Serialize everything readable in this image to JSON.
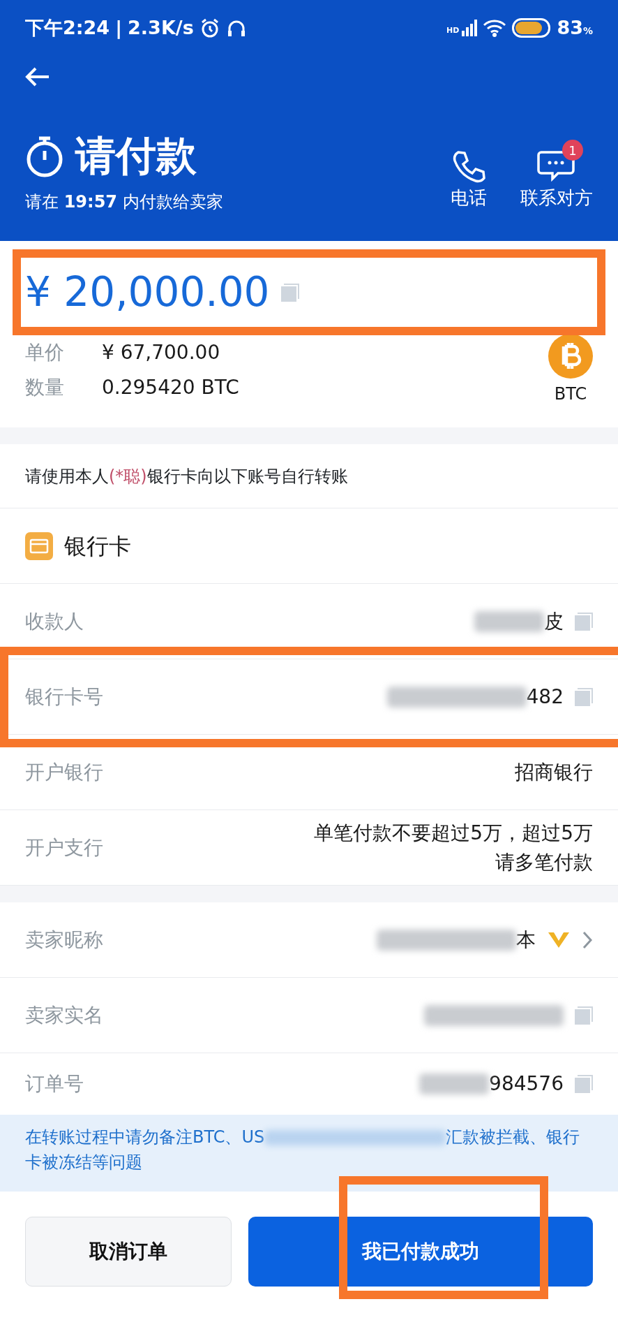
{
  "status_bar": {
    "time": "下午2:24",
    "separator": "|",
    "speed": "2.3K/s",
    "network": "HD",
    "battery": "83",
    "battery_unit": "%"
  },
  "header": {
    "title": "请付款",
    "deadline": "请在 **19:57** 内付款给卖家",
    "actions": [
      {
        "kind": "phone",
        "label": "电话"
      },
      {
        "kind": "chat",
        "label": "联系对方",
        "badge": "1"
      }
    ]
  },
  "order": {
    "amount": "¥ 20,000.00",
    "amount_highlighted": true,
    "details": [
      {
        "label": "单价",
        "value": "¥ 67,700.00"
      },
      {
        "label": "数量",
        "value": "0.295420 BTC"
      }
    ],
    "coin": "BTC"
  },
  "instruction": {
    "before": "请使用本人",
    "name": "(*聪)",
    "after": "银行卡向以下账号自行转账"
  },
  "payment_method": "银行卡",
  "bank_rows": [
    {
      "label": "收款人",
      "value": "皮",
      "redacted": true,
      "copyable": true,
      "highlighted": false
    },
    {
      "label": "银行卡号",
      "value": "482",
      "redacted": true,
      "copyable": true,
      "highlighted": true
    },
    {
      "label": "开户银行",
      "value": "招商银行",
      "redacted": false,
      "copyable": false,
      "highlighted": false
    },
    {
      "label": "开户支行",
      "value": "单笔付款不要超过5万，超过5万",
      "value_line_2": "请多笔付款",
      "redacted": false,
      "copyable": false,
      "highlighted": false
    }
  ],
  "seller_rows": [
    {
      "label": "卖家昵称",
      "value": "本",
      "redacted": true,
      "copyable": false,
      "vip": true,
      "arrow": true
    },
    {
      "label": "卖家实名",
      "redacted": true,
      "copyable": true,
      "vip": false,
      "arrow": false
    },
    {
      "label": "订单号",
      "value": "984576",
      "redacted": true,
      "copyable": true,
      "vip": false,
      "arrow": false
    }
  ],
  "notice": {
    "before": "在转账过程中请勿备注BTC、US",
    "after": "汇款被拦截、银行卡被冻结等问题"
  },
  "buttons": [
    {
      "kind": "secondary",
      "label": "取消订单",
      "highlighted": false
    },
    {
      "kind": "primary",
      "label": "我已付款成功",
      "highlighted": true
    }
  ]
}
